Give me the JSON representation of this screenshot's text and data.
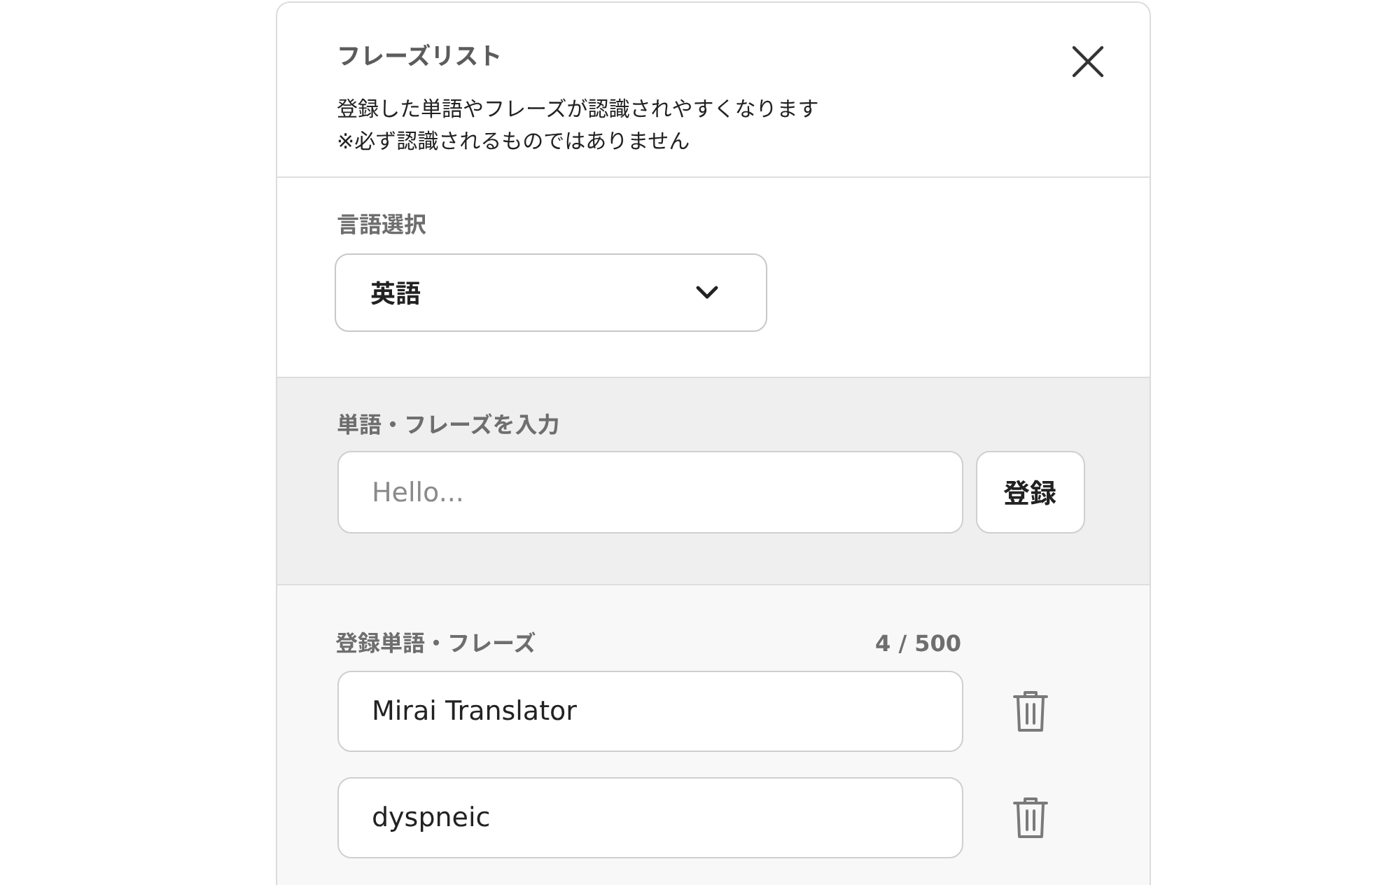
{
  "dialog": {
    "title": "フレーズリスト",
    "description": "登録した単語やフレーズが認識されやすくなります",
    "note": "※必ず認識されるものではありません"
  },
  "language": {
    "label": "言語選択",
    "value": "英語"
  },
  "add_phrase": {
    "label": "単語・フレーズを入力",
    "placeholder": "Hello...",
    "button": "登録"
  },
  "registered": {
    "label": "登録単語・フレーズ",
    "count": "4 / 500",
    "items": [
      {
        "value": "Mirai Translator"
      },
      {
        "value": "dyspneic"
      }
    ]
  }
}
